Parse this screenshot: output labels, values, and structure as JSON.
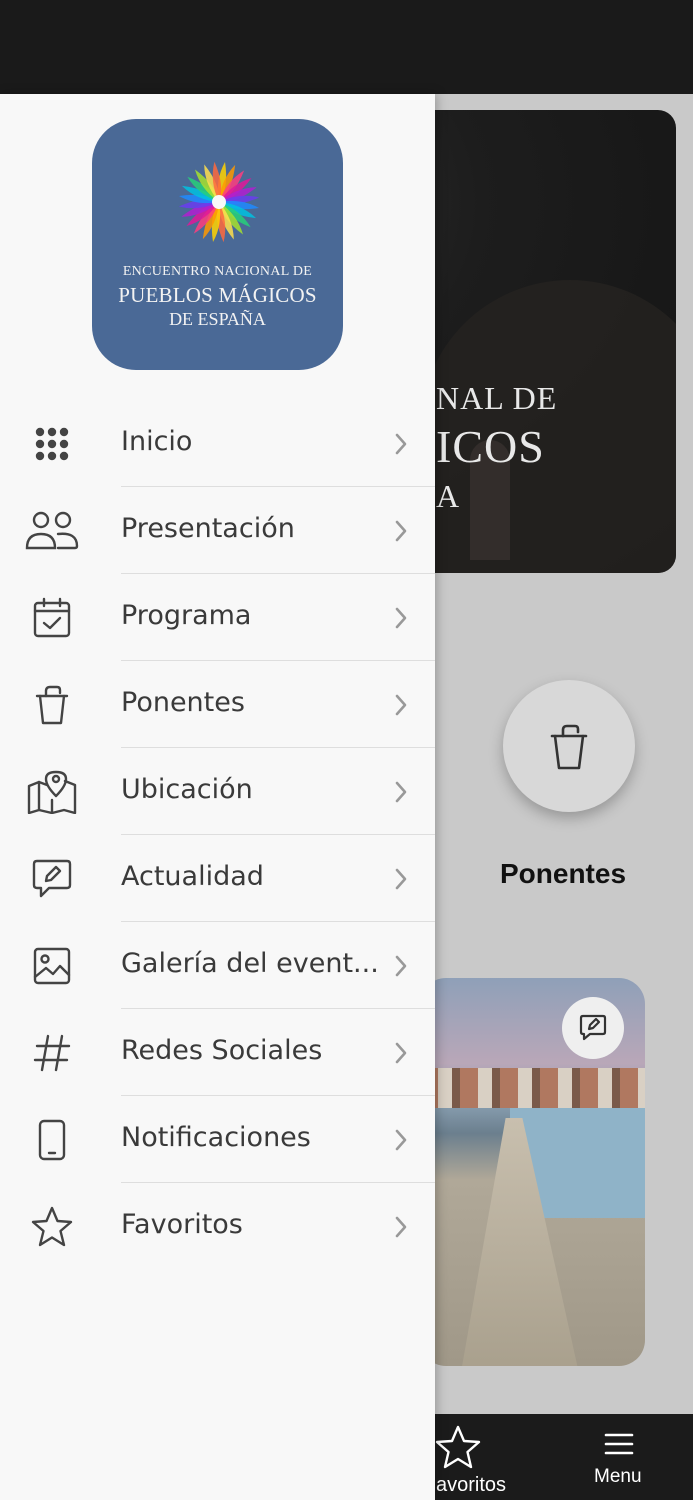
{
  "background": {
    "hero": {
      "line1": "NAL DE",
      "line2": "ICOS",
      "line3": "A"
    },
    "ponentes_label": "Ponentes",
    "bottom_nav": {
      "favoritos_label": "avoritos",
      "menu_label": "Menu"
    }
  },
  "drawer": {
    "logo": {
      "line1": "ENCUENTRO NACIONAL DE",
      "line2": "PUEBLOS MÁGICOS",
      "line3": "DE ESPAÑA"
    },
    "items": [
      {
        "label": "Inicio",
        "icon": "grid-icon"
      },
      {
        "label": "Presentación",
        "icon": "people-icon"
      },
      {
        "label": "Programa",
        "icon": "calendar-check-icon"
      },
      {
        "label": "Ponentes",
        "icon": "bucket-icon"
      },
      {
        "label": "Ubicación",
        "icon": "map-pin-icon"
      },
      {
        "label": "Actualidad",
        "icon": "edit-message-icon"
      },
      {
        "label": "Galería del event...",
        "icon": "image-icon"
      },
      {
        "label": "Redes Sociales",
        "icon": "hashtag-icon"
      },
      {
        "label": "Notificaciones",
        "icon": "phone-icon"
      },
      {
        "label": "Favoritos",
        "icon": "star-icon"
      }
    ]
  },
  "colors": {
    "logo_bg": "#4a6996",
    "drawer_bg": "#f8f8f8",
    "text": "#3a3a3a",
    "icon": "#444444"
  }
}
